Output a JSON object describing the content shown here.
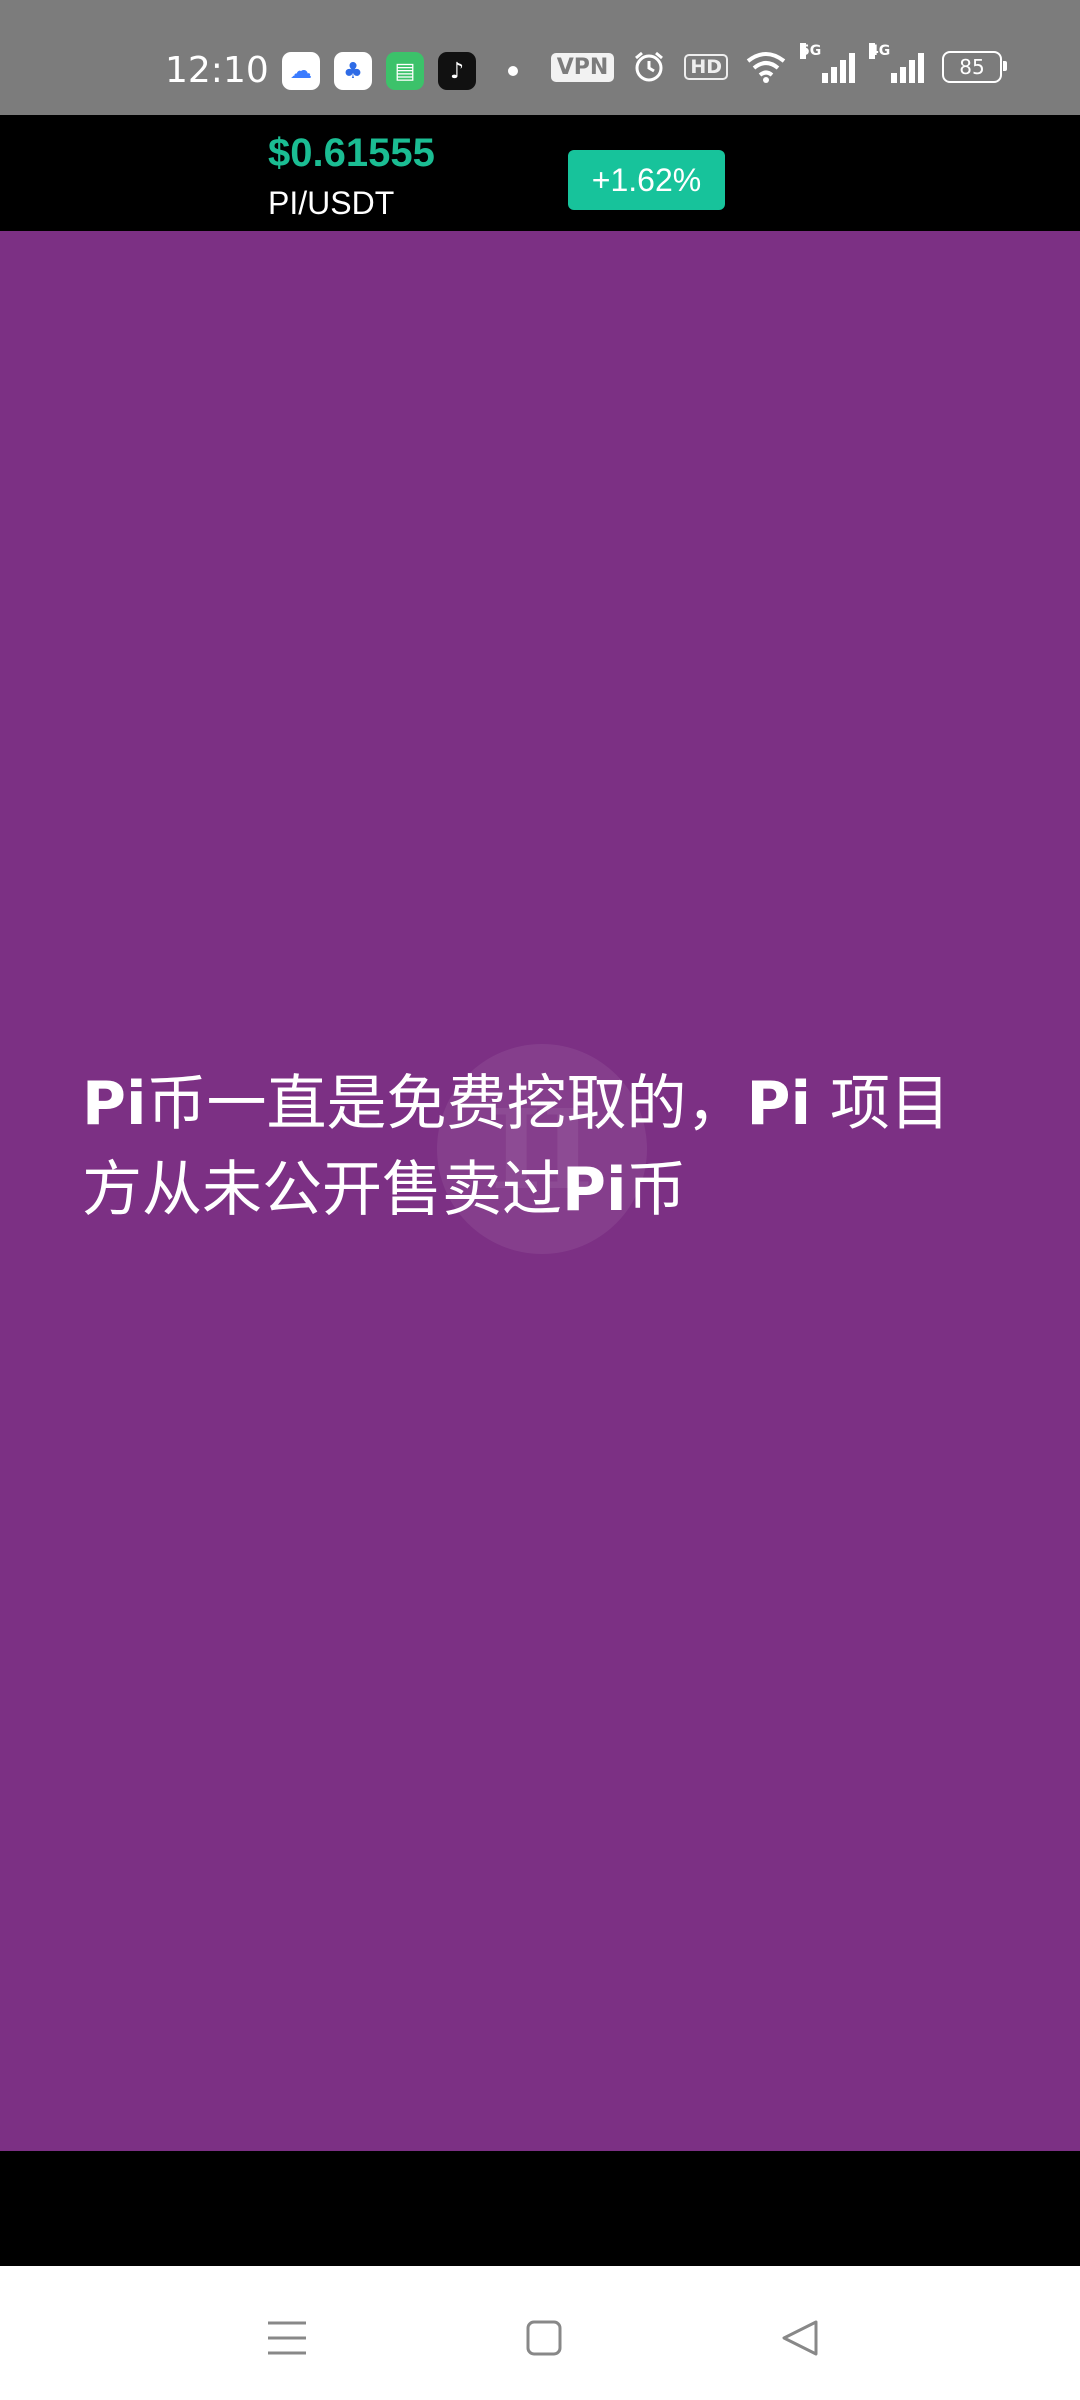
{
  "status_bar": {
    "time": "12:10",
    "apps": [
      {
        "icon": "cloud-app-icon",
        "glyph": "☁"
      },
      {
        "icon": "baidu-icon",
        "glyph": "♣"
      },
      {
        "icon": "messages-icon",
        "glyph": "▤"
      },
      {
        "icon": "tiktok-icon",
        "glyph": "♪"
      }
    ],
    "vpn": "VPN",
    "hd": "HD",
    "net1": "5G",
    "net2": "4G",
    "battery": "85"
  },
  "ticker": {
    "price": "$0.61555",
    "pair": "PI/USDT",
    "change": "+1.62%",
    "price_color": "#1bbd93",
    "badge_color": "#17c39b"
  },
  "content": {
    "background": "#7c3084",
    "caption_line1": [
      "Pi",
      "币一直是免费挖取的，",
      "Pi",
      " 项目"
    ],
    "caption_line2": [
      "方从未公开售卖过",
      "Pi",
      "币"
    ],
    "watermark_icon": "play-watermark-icon"
  },
  "nav": {
    "menu_icon": "menu-icon",
    "home_icon": "home-icon",
    "back_icon": "back-icon"
  }
}
